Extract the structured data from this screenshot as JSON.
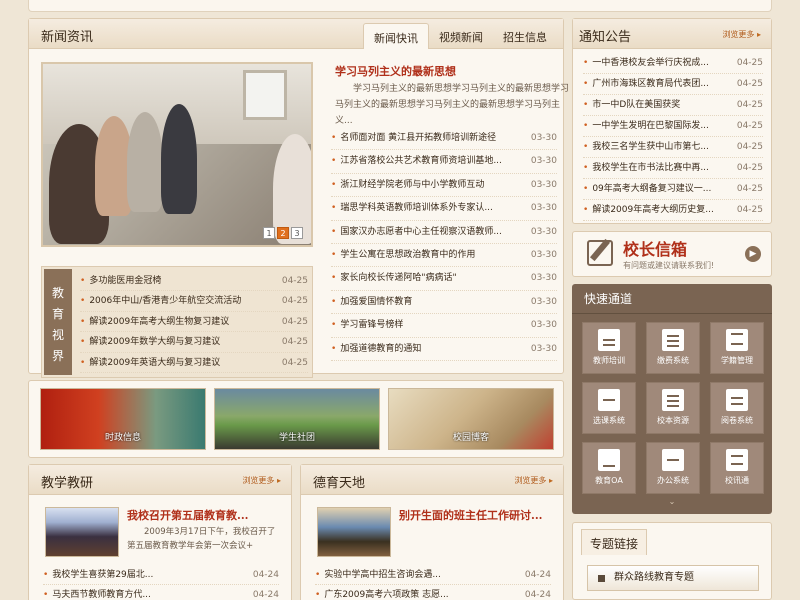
{
  "news": {
    "title": "新闻资讯",
    "tabs": [
      "新闻快讯",
      "视频新闻",
      "招生信息"
    ],
    "headline": "学习马列主义的最新思想",
    "summary": "学习马列主义的最新思想学习马列主义的最新思想学习马列主义的最新思想学习马列主义的最新思想学习马列主义...",
    "pager": [
      "1",
      "2",
      "3"
    ],
    "items": [
      {
        "title": "名师面对面 黄江县开拓教师培训新途径",
        "date": "03-30"
      },
      {
        "title": "江苏省落校公共艺术教育师资培训基地...",
        "date": "03-30"
      },
      {
        "title": "浙江财经学院老师与中小学教师互动",
        "date": "03-30"
      },
      {
        "title": "瑞思学科英语教师培训体系外专家认...",
        "date": "03-30"
      },
      {
        "title": "国家汉办志愿者中心主任视察汉语教师...",
        "date": "03-30"
      },
      {
        "title": "学生公寓在思想政治教育中的作用",
        "date": "03-30"
      },
      {
        "title": "家长向校长传递阿哈\"病病话\"",
        "date": "03-30"
      },
      {
        "title": "加强爱国情怀教育",
        "date": "03-30"
      },
      {
        "title": "学习雷锋号榜样",
        "date": "03-30"
      },
      {
        "title": "加强道德教育的通知",
        "date": "03-30"
      }
    ]
  },
  "vision": {
    "label": "教育视界",
    "items": [
      {
        "title": "多功能医用金冠椅",
        "date": "04-25"
      },
      {
        "title": "2006年中山/香港青少年航空交流活动",
        "date": "04-25"
      },
      {
        "title": "解读2009年高考大纲生物复习建议",
        "date": "04-25"
      },
      {
        "title": "解读2009年数学大纲与复习建议",
        "date": "04-25"
      },
      {
        "title": "解读2009年英语大纲与复习建议",
        "date": "04-25"
      }
    ]
  },
  "banners": [
    "时政信息",
    "学生社团",
    "校园博客"
  ],
  "notice": {
    "title": "通知公告",
    "more": "浏览更多",
    "items": [
      {
        "title": "一中香港校友会举行庆祝成...",
        "date": "04-25"
      },
      {
        "title": "广州市海珠区教育局代表团...",
        "date": "04-25"
      },
      {
        "title": "市一中D队在美国获奖",
        "date": "04-25"
      },
      {
        "title": "一中学生发明在巴黎国际发...",
        "date": "04-25"
      },
      {
        "title": "我校三名学生获中山市第七...",
        "date": "04-25"
      },
      {
        "title": "我校学生在市书法比赛中再...",
        "date": "04-25"
      },
      {
        "title": "09年高考大纲备复习建议一...",
        "date": "04-25"
      },
      {
        "title": "解读2009年高考大纲历史复...",
        "date": "04-25"
      }
    ]
  },
  "principal": {
    "title": "校长信箱",
    "subtitle": "有问题或建议请联系我们!"
  },
  "quick": {
    "title": "快速通道",
    "items": [
      "教师培训",
      "缴费系统",
      "学籍管理",
      "选课系统",
      "校本资源",
      "阅卷系统",
      "教育OA",
      "办公系统",
      "校讯通"
    ],
    "icons": [
      "person-icon",
      "money-icon",
      "disk-icon",
      "check-icon",
      "document-icon",
      "presentation-icon",
      "monitor-icon",
      "briefcase-icon",
      "phone-icon"
    ]
  },
  "teaching": {
    "title": "教学教研",
    "more": "浏览更多",
    "feature_title": "我校召开第五届教育教...",
    "feature_text": "2009年3月17日下午，我校召开了第五届教育教学年会第一次会议+",
    "items": [
      {
        "title": "我校学生喜获第29届北...",
        "date": "04-24"
      },
      {
        "title": "马夫西节教师教育方代...",
        "date": "04-24"
      }
    ]
  },
  "moral": {
    "title": "德育天地",
    "more": "浏览更多",
    "feature_title": "别开生面的班主任工作研讨...",
    "items": [
      {
        "title": "实验中学高中招生咨询会遇...",
        "date": "04-24"
      },
      {
        "title": "广东2009高考六项政策 志愿...",
        "date": "04-24"
      }
    ]
  },
  "special": {
    "title": "专题链接",
    "button": "群众路线教育专题"
  },
  "colors": {
    "accent": "#b0301a",
    "brand": "#7a6452",
    "bullet": "#d06020"
  }
}
